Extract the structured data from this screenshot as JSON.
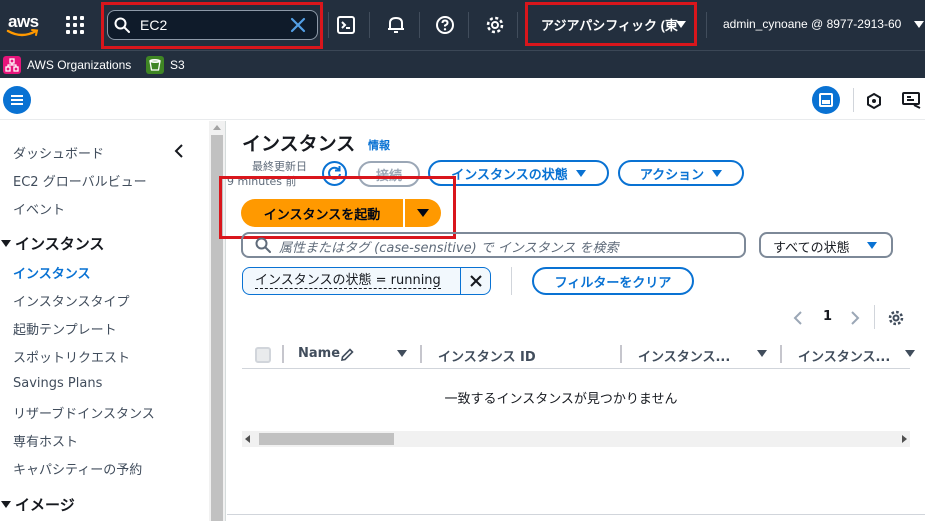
{
  "topnav": {
    "logo_text": "aws",
    "search_value": "EC2",
    "region": "アジアパシフィック (東",
    "account": "admin_cynoane @ 8977-2913-60"
  },
  "favorites": [
    {
      "label": "AWS Organizations",
      "color": "#e7157b"
    },
    {
      "label": "S3",
      "color": "#3f8624"
    }
  ],
  "sidebar": {
    "items_top": [
      "ダッシュボード",
      "EC2 グローバルビュー",
      "イベント"
    ],
    "section_instances": "インスタンス",
    "instances_items": [
      "インスタンス",
      "インスタンスタイプ",
      "起動テンプレート",
      "スポットリクエスト",
      "Savings Plans",
      "リザーブドインスタンス",
      "専有ホスト",
      "キャパシティーの予約"
    ],
    "section_images": "イメージ"
  },
  "main": {
    "title": "インスタンス",
    "info": "情報",
    "last_updated_label": "最終更新日",
    "last_updated_value": "9 minutes 前",
    "connect": "接続",
    "instance_state": "インスタンスの状態",
    "actions": "アクション",
    "launch": "インスタンスを起動",
    "filter_placeholder": "属性またはタグ (case-sensitive) で インスタンス を検索",
    "state_select": "すべての状態",
    "token": "インスタンスの状態 = running",
    "clear_filters": "フィルターをクリア",
    "page": "1",
    "columns": [
      "Name",
      "インスタンス ID",
      "インスタンス...",
      "インスタンス..."
    ],
    "empty": "一致するインスタンスが見つかりません"
  },
  "colors": {
    "nav_bg": "#232f3e",
    "accent": "#0972d3",
    "launch": "#ff9900",
    "highlight": "#d9161c"
  }
}
